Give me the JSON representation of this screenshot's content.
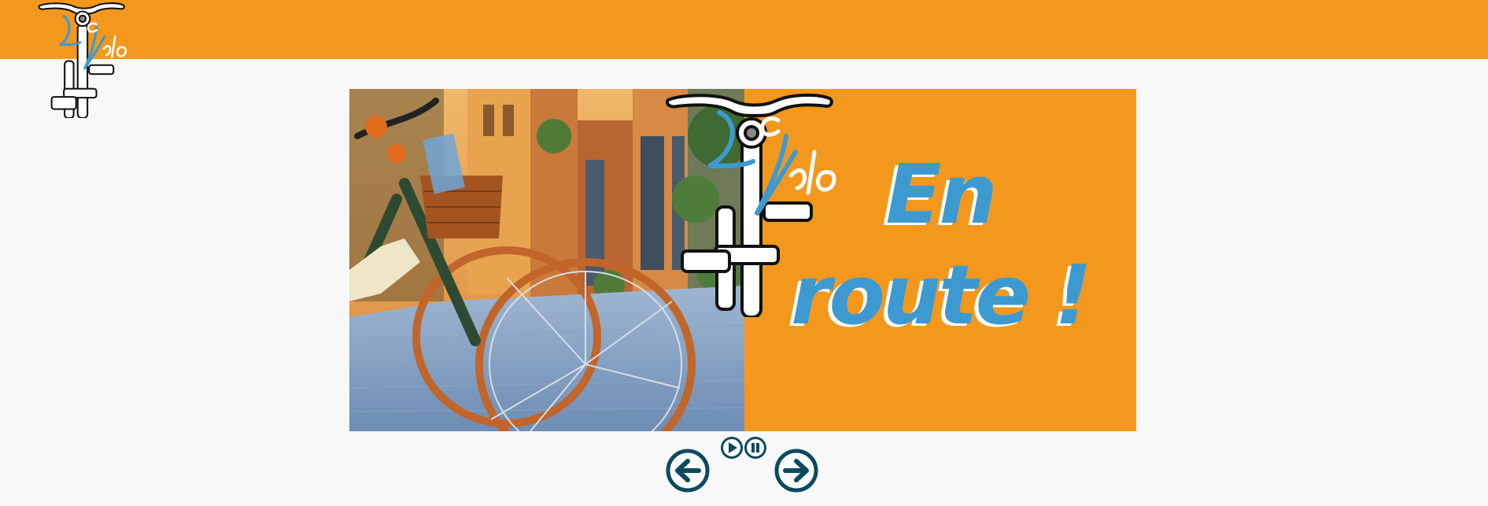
{
  "colors": {
    "brand_orange": "#f3981d",
    "page_background": "#f8f8f8",
    "title_blue": "#3d9ad1",
    "control_dark_teal": "#0b4a5e"
  },
  "header": {
    "logo_icon": "loc-velo-bike-logo-icon"
  },
  "carousel": {
    "slide": {
      "title_line1": "En",
      "title_line2": "route !",
      "photo": "bicycles-on-cobblestone-street-image",
      "logo_icon": "loc-velo-bike-logo-icon"
    },
    "controls": {
      "prev_icon": "arrow-left-icon",
      "play_icon": "play-icon",
      "pause_icon": "pause-icon",
      "next_icon": "arrow-right-icon"
    }
  }
}
